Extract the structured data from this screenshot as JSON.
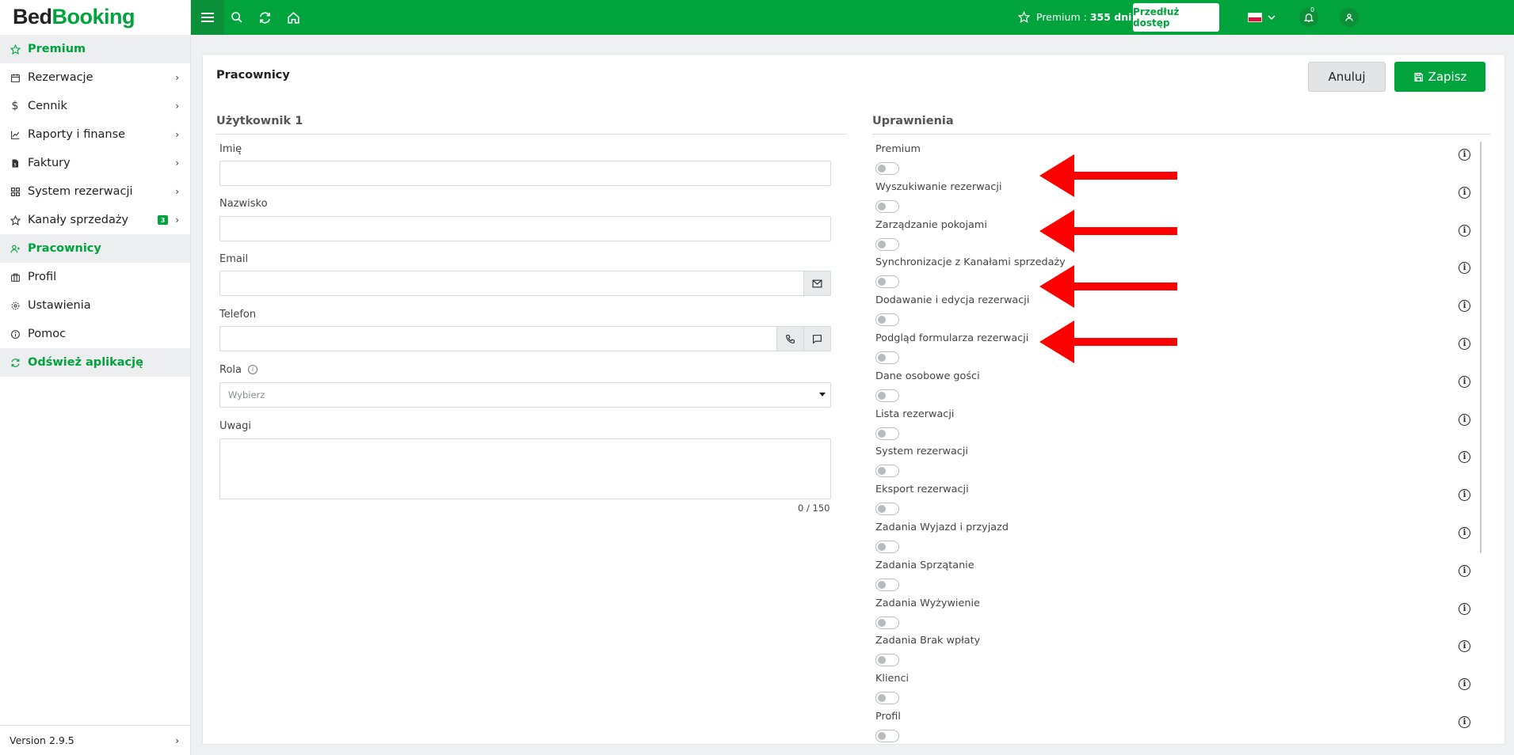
{
  "logo": {
    "part1": "Bed",
    "part2": "Booking"
  },
  "sidebar": {
    "items": [
      {
        "label": "Premium",
        "icon": "star-icon",
        "chevron": false
      },
      {
        "label": "Rezerwacje",
        "icon": "calendar-icon",
        "chevron": true
      },
      {
        "label": "Cennik",
        "icon": "dollar-icon",
        "chevron": true
      },
      {
        "label": "Raporty i finanse",
        "icon": "chart-icon",
        "chevron": true
      },
      {
        "label": "Faktury",
        "icon": "invoice-icon",
        "chevron": true
      },
      {
        "label": "System rezerwacji",
        "icon": "grid-icon",
        "chevron": true
      },
      {
        "label": "Kanały sprzedaży",
        "icon": "star-outline-icon",
        "chevron": true,
        "badge": "3"
      },
      {
        "label": "Pracownicy",
        "icon": "user-plus-icon",
        "chevron": false
      },
      {
        "label": "Profil",
        "icon": "briefcase-icon",
        "chevron": false
      },
      {
        "label": "Ustawienia",
        "icon": "gear-icon",
        "chevron": false
      },
      {
        "label": "Pomoc",
        "icon": "info-icon",
        "chevron": false
      },
      {
        "label": "Odśwież aplikację",
        "icon": "refresh-icon",
        "chevron": false
      }
    ],
    "version": "Version 2.9.5"
  },
  "topbar": {
    "premium_label": "Premium :",
    "premium_days": "355 dni",
    "extend_button": "Przedłuż dostęp",
    "notifications_count": "0"
  },
  "page": {
    "title": "Pracownicy",
    "cancel_button": "Anuluj",
    "save_button": "Zapisz"
  },
  "form": {
    "section_title": "Użytkownik 1",
    "first_name_label": "Imię",
    "last_name_label": "Nazwisko",
    "email_label": "Email",
    "phone_label": "Telefon",
    "role_label": "Rola",
    "role_placeholder": "Wybierz",
    "notes_label": "Uwagi",
    "notes_counter": "0 / 150"
  },
  "permissions": {
    "section_title": "Uprawnienia",
    "items": [
      "Premium",
      "Wyszukiwanie rezerwacji",
      "Zarządzanie pokojami",
      "Synchronizacje z Kanałami sprzedaży",
      "Dodawanie i edycja rezerwacji",
      "Podgląd formularza rezerwacji",
      "Dane osobowe gości",
      "Lista rezerwacji",
      "System rezerwacji",
      "Eksport rezerwacji",
      "Zadania Wyjazd i przyjazd",
      "Zadania Sprzątanie",
      "Zadania Wyżywienie",
      "Zadania Brak wpłaty",
      "Klienci",
      "Profil"
    ]
  },
  "colors": {
    "brand_green": "#00a33c",
    "annotation_arrow": "#ff0000"
  }
}
